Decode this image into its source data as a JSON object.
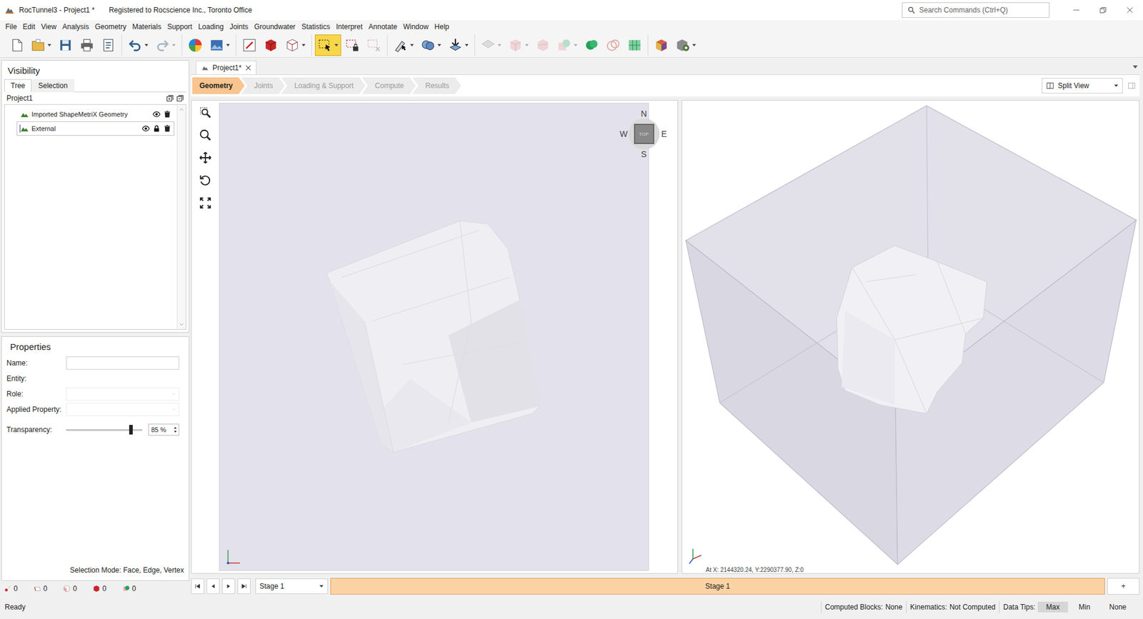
{
  "window": {
    "title": "RocTunnel3 - Project1 *",
    "registration": "Registered to Rocscience Inc., Toronto Office"
  },
  "search": {
    "placeholder": "Search Commands (Ctrl+Q)"
  },
  "menu": [
    "File",
    "Edit",
    "View",
    "Analysis",
    "Geometry",
    "Materials",
    "Support",
    "Loading",
    "Joints",
    "Groundwater",
    "Statistics",
    "Interpret",
    "Annotate",
    "Window",
    "Help"
  ],
  "toolbar": [
    [
      {
        "kind": "new",
        "dropdown": false,
        "selected": false,
        "disabled": false
      },
      {
        "kind": "open",
        "dropdown": true,
        "selected": false,
        "disabled": false
      },
      {
        "kind": "save",
        "dropdown": false,
        "selected": false,
        "disabled": false
      },
      {
        "kind": "print",
        "dropdown": false,
        "selected": false,
        "disabled": false
      },
      {
        "kind": "report",
        "dropdown": false,
        "selected": false,
        "disabled": false
      }
    ],
    [
      {
        "kind": "undo",
        "dropdown": true,
        "selected": false,
        "disabled": false
      },
      {
        "kind": "redo",
        "dropdown": true,
        "selected": false,
        "disabled": true
      }
    ],
    [
      {
        "kind": "colors",
        "dropdown": false,
        "selected": false,
        "disabled": false
      },
      {
        "kind": "image",
        "dropdown": true,
        "selected": false,
        "disabled": false
      }
    ],
    [
      {
        "kind": "pencil",
        "dropdown": false,
        "selected": false,
        "disabled": false
      },
      {
        "kind": "solid",
        "dropdown": false,
        "selected": false,
        "disabled": false
      },
      {
        "kind": "wireframe",
        "dropdown": true,
        "selected": false,
        "disabled": false
      }
    ],
    [
      {
        "kind": "select",
        "dropdown": true,
        "selected": true,
        "disabled": false
      },
      {
        "kind": "select-lock",
        "dropdown": false,
        "selected": false,
        "disabled": false
      },
      {
        "kind": "deselect",
        "dropdown": false,
        "selected": false,
        "disabled": true
      }
    ],
    [
      {
        "kind": "pick",
        "dropdown": true,
        "selected": false,
        "disabled": false
      },
      {
        "kind": "shapes",
        "dropdown": true,
        "selected": false,
        "disabled": false
      },
      {
        "kind": "import",
        "dropdown": true,
        "selected": false,
        "disabled": false
      }
    ],
    [
      {
        "kind": "plane",
        "dropdown": true,
        "selected": false,
        "disabled": true
      },
      {
        "kind": "block",
        "dropdown": true,
        "selected": false,
        "disabled": true
      },
      {
        "kind": "block-cut",
        "dropdown": false,
        "selected": false,
        "disabled": true
      },
      {
        "kind": "sphere",
        "dropdown": true,
        "selected": false,
        "disabled": true
      },
      {
        "kind": "union",
        "dropdown": false,
        "selected": false,
        "disabled": false
      },
      {
        "kind": "subtract",
        "dropdown": false,
        "selected": false,
        "disabled": true
      },
      {
        "kind": "grid",
        "dropdown": false,
        "selected": false,
        "disabled": false
      }
    ],
    [
      {
        "kind": "blocks",
        "dropdown": false,
        "selected": false,
        "disabled": false
      },
      {
        "kind": "settings",
        "dropdown": true,
        "selected": false,
        "disabled": false
      }
    ]
  ],
  "visibility": {
    "title": "Visibility",
    "tabs": [
      {
        "label": "Tree",
        "selected": true
      },
      {
        "label": "Selection",
        "selected": false
      }
    ],
    "root": "Project1",
    "items": [
      {
        "label": "Imported ShapeMetriX Geometry",
        "kind": "geometry",
        "visible": true,
        "locked": false,
        "selected": false
      },
      {
        "label": "External",
        "kind": "external",
        "visible": true,
        "locked": true,
        "selected": true
      }
    ]
  },
  "properties": {
    "title": "Properties",
    "fields": [
      {
        "label": "Name:",
        "kind": "text",
        "disabled": false
      },
      {
        "label": "Entity:",
        "kind": "static",
        "disabled": false
      },
      {
        "label": "Role:",
        "kind": "select",
        "disabled": true
      },
      {
        "label": "Applied Property:",
        "kind": "select",
        "disabled": true
      }
    ],
    "transparency": {
      "label": "Transparency:",
      "level": 0.85,
      "reading": "85 %"
    },
    "selection_mode": "Selection Mode: Face, Edge, Vertex",
    "counts": [
      {
        "kind": "vertex",
        "value": "0"
      },
      {
        "kind": "edge",
        "value": "0"
      },
      {
        "kind": "face",
        "value": "0"
      },
      {
        "kind": "block",
        "value": "0"
      },
      {
        "kind": "joint",
        "value": "0"
      }
    ]
  },
  "document_tab": {
    "label": "Project1*",
    "selected": true
  },
  "workflow": [
    {
      "label": "Geometry",
      "selected": true,
      "disabled": false
    },
    {
      "label": "Joints",
      "selected": false,
      "disabled": true
    },
    {
      "label": "Loading & Support",
      "selected": false,
      "disabled": true
    },
    {
      "label": "Compute",
      "selected": false,
      "disabled": true
    },
    {
      "label": "Results",
      "selected": false,
      "disabled": true
    }
  ],
  "view_mode": "Split View",
  "compass": {
    "north": "N",
    "south": "S",
    "west": "W",
    "east": "E",
    "face": "TOP"
  },
  "coordinates": "At X: 2144320.24, Y:2290377.90, Z:0",
  "stage": {
    "current": "Stage 1",
    "tabs": [
      {
        "label": "Stage 1",
        "selected": true
      }
    ],
    "add": "+"
  },
  "status": {
    "message": "Ready",
    "items": [
      {
        "label": "Computed Blocks:",
        "value": "None"
      },
      {
        "label": "Kinematics:",
        "value": "Not Computed"
      }
    ],
    "data_tips": {
      "label": "Data Tips:",
      "options": [
        {
          "label": "Max",
          "selected": true
        },
        {
          "label": "Min",
          "selected": false
        },
        {
          "label": "None",
          "selected": false
        }
      ]
    }
  }
}
